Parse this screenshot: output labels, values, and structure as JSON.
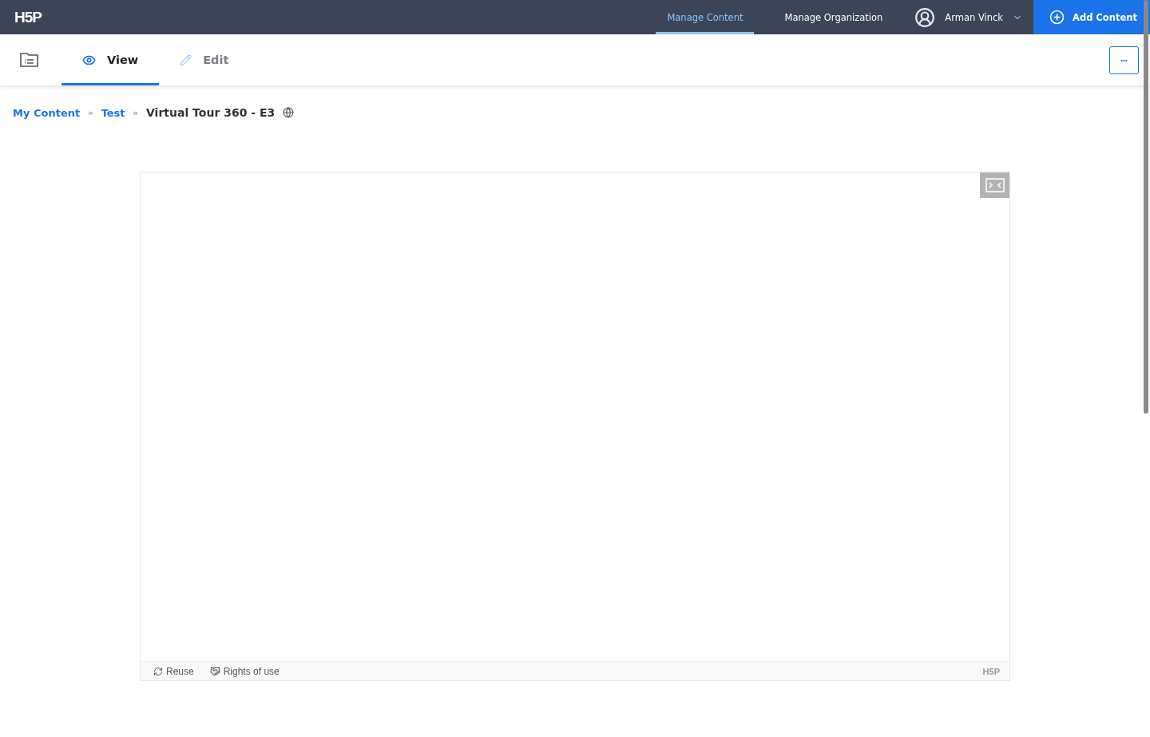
{
  "header": {
    "logo": "H5P",
    "nav": [
      {
        "label": "Manage Content",
        "selected": true
      },
      {
        "label": "Manage Organization",
        "selected": false
      }
    ],
    "user": "Arman Vinck",
    "add_button": "Add Content"
  },
  "tabs": [
    {
      "label": "View",
      "kind": "view",
      "selected": true
    },
    {
      "label": "Edit",
      "kind": "edit",
      "selected": false
    }
  ],
  "more_button": "•••",
  "breadcrumb": {
    "links": [
      "My Content",
      "Test"
    ],
    "separator": "»",
    "current": "Virtual Tour 360 - E3"
  },
  "player": {
    "footer_actions": [
      {
        "label": "Reuse",
        "kind": "reuse"
      },
      {
        "label": "Rights of use",
        "kind": "rights"
      }
    ],
    "footer_logo": "H5P"
  }
}
